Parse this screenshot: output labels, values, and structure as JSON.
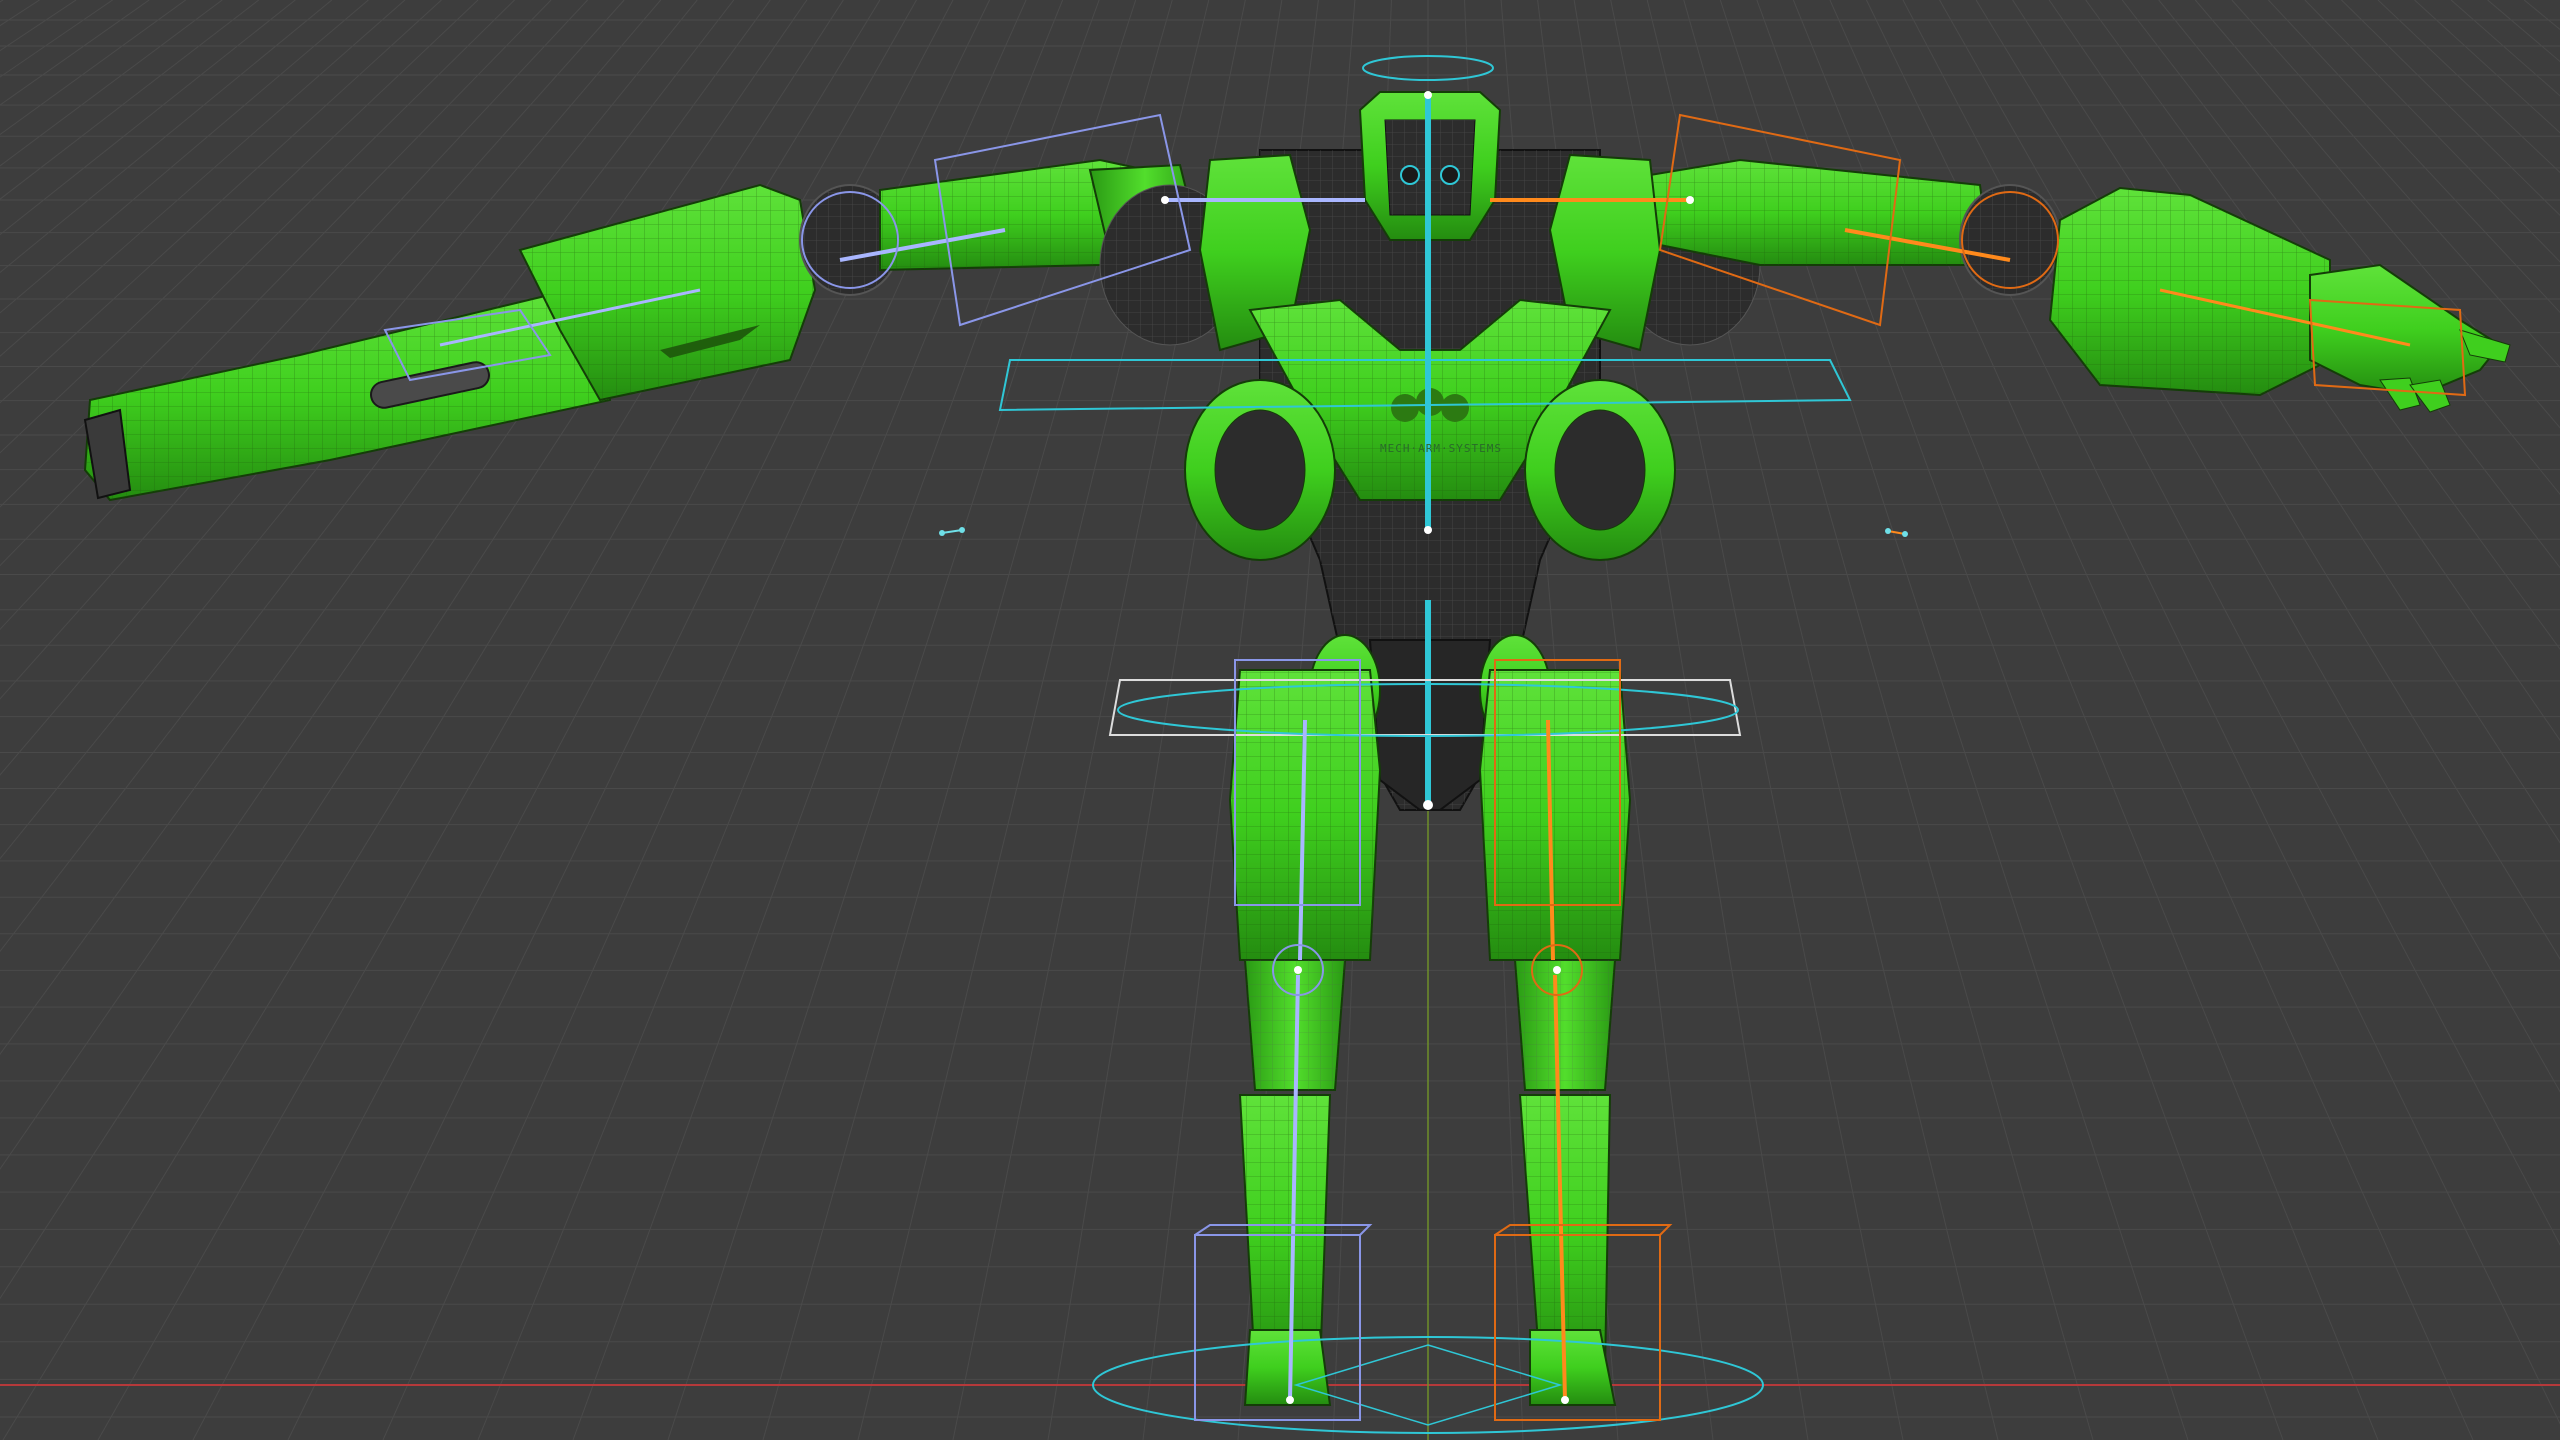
{
  "app": {
    "name": "",
    "view": "3D Viewport"
  },
  "viewport": {
    "shading": "wireframe overlay",
    "colors": {
      "background": "#3d3d3d",
      "grid": "#4a4a4a",
      "mesh": "#3fcf1e",
      "mesh_dark": "#2a8f12",
      "mesh_shadow": "#1f5f0c",
      "body_gray": "#2c2c2c",
      "bone_center": "#2fc7d6",
      "bone_left": "#a9b6ff",
      "bone_right": "#ff8a1c",
      "x_axis": "#b5393a",
      "y_axis": "#6f8f2a"
    }
  },
  "scene": {
    "object": "robot-rig",
    "chest_text": "MECH·ARM·SYSTEMS"
  }
}
